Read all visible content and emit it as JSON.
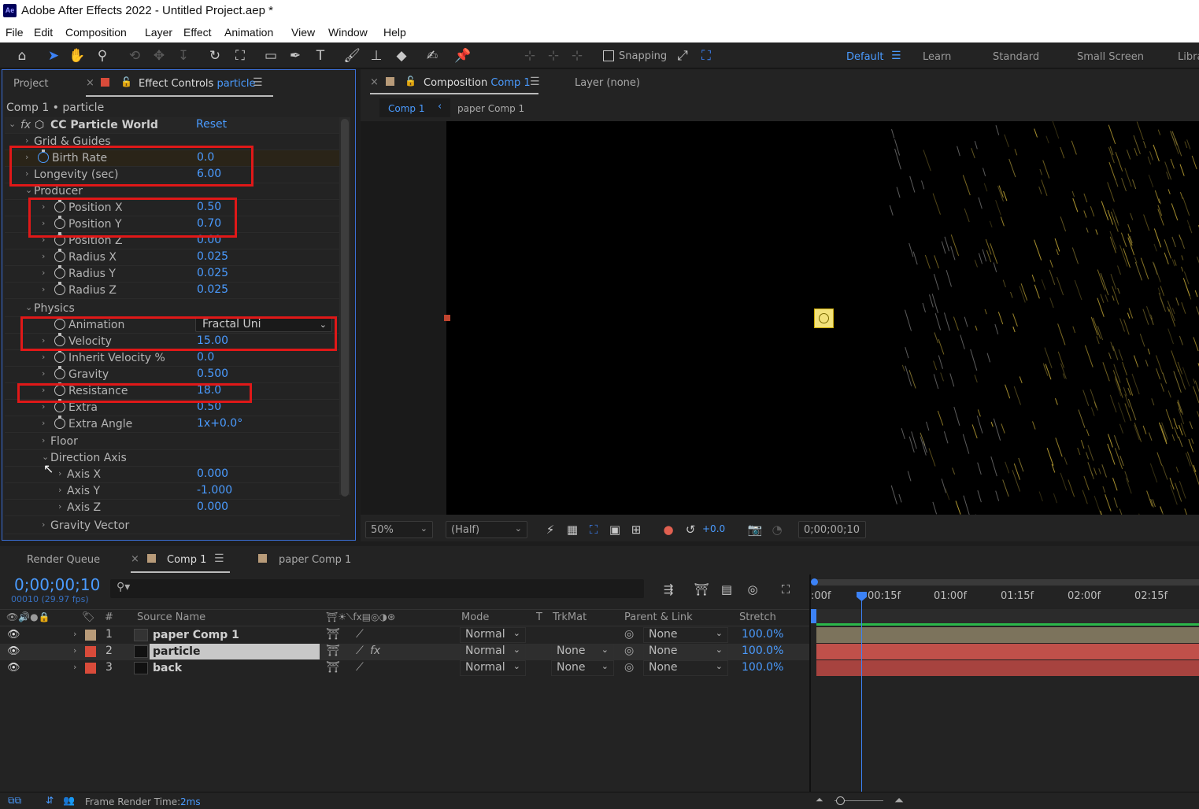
{
  "window": {
    "title": "Adobe After Effects 2022 - Untitled Project.aep *",
    "app_badge": "Ae"
  },
  "menu": [
    "File",
    "Edit",
    "Composition",
    "Layer",
    "Effect",
    "Animation",
    "View",
    "Window",
    "Help"
  ],
  "toolbar": {
    "snapping_label": "Snapping",
    "workspaces": [
      "Default",
      "Learn",
      "Standard",
      "Small Screen",
      "Libra"
    ]
  },
  "left_panel": {
    "tab_project": "Project",
    "tab_effect_controls": "Effect Controls",
    "tab_effect_controls_target": "particle",
    "subtitle": "Comp 1 • particle",
    "effect_name": "CC Particle World",
    "reset_label": "Reset",
    "rows": [
      {
        "label": "Grid & Guides",
        "value": ""
      },
      {
        "label": "Birth Rate",
        "value": "0.0"
      },
      {
        "label": "Longevity (sec)",
        "value": "6.00"
      },
      {
        "label": "Producer",
        "value": ""
      },
      {
        "label": "Position X",
        "value": "0.50"
      },
      {
        "label": "Position Y",
        "value": "0.70"
      },
      {
        "label": "Position Z",
        "value": "0.00"
      },
      {
        "label": "Radius X",
        "value": "0.025"
      },
      {
        "label": "Radius Y",
        "value": "0.025"
      },
      {
        "label": "Radius Z",
        "value": "0.025"
      },
      {
        "label": "Physics",
        "value": ""
      },
      {
        "label": "Animation",
        "value": "Fractal Uni"
      },
      {
        "label": "Velocity",
        "value": "15.00"
      },
      {
        "label": "Inherit Velocity %",
        "value": "0.0"
      },
      {
        "label": "Gravity",
        "value": "0.500"
      },
      {
        "label": "Resistance",
        "value": "18.0"
      },
      {
        "label": "Extra",
        "value": "0.50"
      },
      {
        "label": "Extra Angle",
        "value": "1x+0.0°"
      },
      {
        "label": "Floor",
        "value": ""
      },
      {
        "label": "Direction Axis",
        "value": ""
      },
      {
        "label": "Axis X",
        "value": "0.000"
      },
      {
        "label": "Axis Y",
        "value": "-1.000"
      },
      {
        "label": "Axis Z",
        "value": "0.000"
      },
      {
        "label": "Gravity Vector",
        "value": ""
      }
    ]
  },
  "comp_panel": {
    "tab_label": "Composition",
    "tab_target": "Comp 1",
    "layer_tab": "Layer (none)",
    "breadcrumb_active": "Comp 1",
    "breadcrumb_other": "paper Comp 1",
    "zoom": "50%",
    "resolution": "(Half)",
    "exposure": "+0.0",
    "timecode": "0;00;00;10"
  },
  "timeline": {
    "tab_render_queue": "Render Queue",
    "tab_comp1": "Comp 1",
    "tab_paper": "paper Comp 1",
    "timecode": "0;00;00;10",
    "timecode_sub": "00010 (29.97 fps)",
    "columns": {
      "hash": "#",
      "source_name": "Source Name",
      "mode": "Mode",
      "t": "T",
      "trkmat": "TrkMat",
      "parent": "Parent & Link",
      "stretch": "Stretch"
    },
    "layers": [
      {
        "num": "1",
        "name": "paper Comp 1",
        "mode": "Normal",
        "trkmat": "",
        "parent": "None",
        "stretch": "100.0%",
        "color": "#b89b79"
      },
      {
        "num": "2",
        "name": "particle",
        "mode": "Normal",
        "trkmat": "None",
        "parent": "None",
        "stretch": "100.0%",
        "color": "#d94b3a"
      },
      {
        "num": "3",
        "name": "back",
        "mode": "Normal",
        "trkmat": "None",
        "parent": "None",
        "stretch": "100.0%",
        "color": "#d94b3a"
      }
    ],
    "ruler": [
      ":00f",
      "00:15f",
      "01:00f",
      "01:15f",
      "02:00f",
      "02:15f"
    ]
  },
  "status": {
    "label": "Frame Render Time:",
    "value": "2ms"
  },
  "colors": {
    "accent": "#4a9bff",
    "highlight_box": "#e01818",
    "panel_bg": "#232323"
  }
}
